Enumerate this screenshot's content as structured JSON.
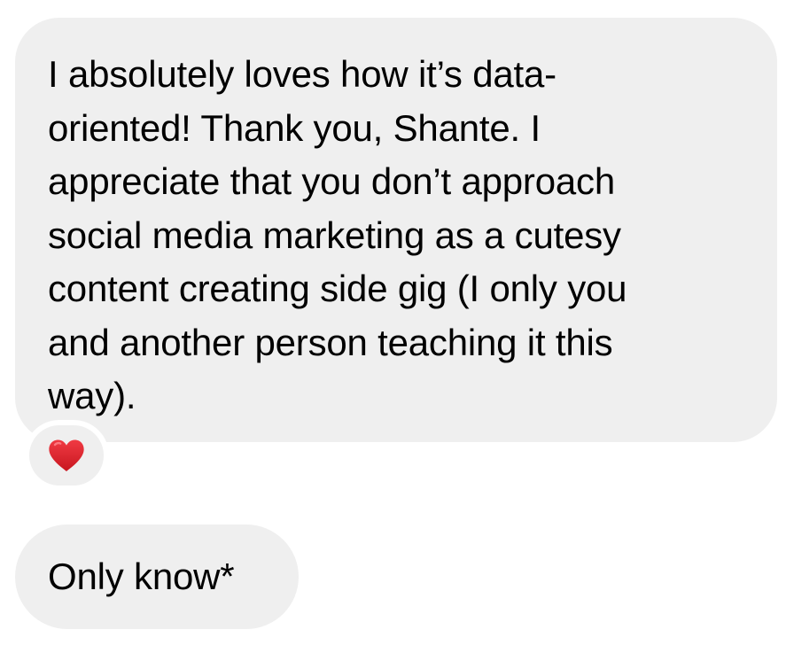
{
  "messages": [
    {
      "text": "I absolutely loves how it’s data-\noriented! Thank you, Shante. I\nappreciate that you don’t approach\nsocial media marketing as a cutesy\ncontent creating side gig (I only you\nand another person teaching it this\nway).",
      "reaction": {
        "emoji": "heart-icon",
        "color": "#e0262f"
      }
    },
    {
      "text": "Only know*"
    }
  ],
  "colors": {
    "bubble_bg": "#efefef",
    "page_bg": "#ffffff",
    "text": "#000000",
    "heart": "#e0262f"
  }
}
